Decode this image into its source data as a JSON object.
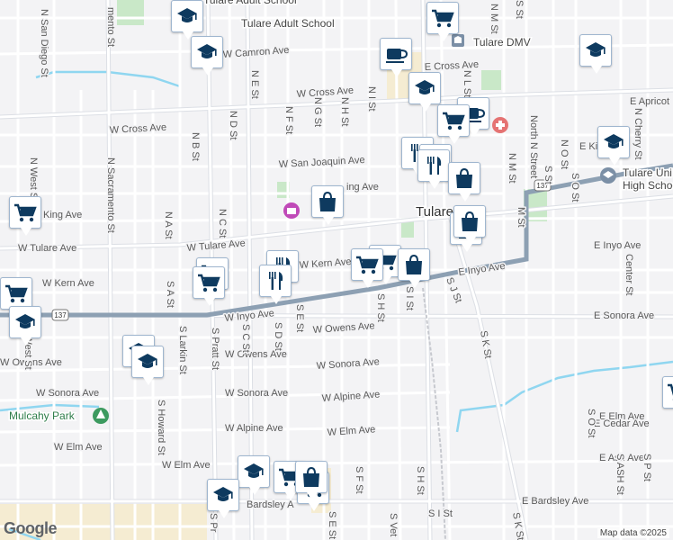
{
  "map": {
    "attribution": "Map data ©2025",
    "logo": "Google",
    "city_label": "Tulare",
    "highway_shield": "137",
    "poi_labels": {
      "adult_school": "Tulare Adult School",
      "dmv": "Tulare DMV",
      "high_school_1": "Tulare Uni",
      "high_school_2": "High School",
      "park": "Mulcahy Park"
    },
    "street_labels": {
      "n_san_diego": "N San Diego St",
      "n_sacramento": "N Sacramento St",
      "n_west": "N West St",
      "s_west": "S West St",
      "n_b": "N B St",
      "n_a": "N A St",
      "n_c": "N C St",
      "n_d": "N D St",
      "n_e": "N E St",
      "n_f": "N F St",
      "n_g": "N G St",
      "n_h": "N H St",
      "n_i": "N I St",
      "n_l": "N L St",
      "n_m": "N M St",
      "m_st": "M St",
      "n_o": "N O St",
      "north_n": "North N Street",
      "s_st": "S St",
      "n_cherry": "N Cherry St",
      "s_o_top": "S O St",
      "memento": "mento St",
      "w_camron": "W Camron Ave",
      "w_cross_1": "W Cross Ave",
      "w_cross_2": "W Cross Ave",
      "e_cross": "E Cross Ave",
      "e_apricot": "E Apricot",
      "e_king": "E King",
      "w_san_joaquin": "W San Joaquin Ave",
      "king_ave": "King Ave",
      "ing_ave": "ing Ave",
      "w_tulare": "W Tulare Ave",
      "w_kern_1": "W Kern Ave",
      "w_kern_2": "W Kern Ave",
      "w_inyo": "W Inyo Ave",
      "e_inyo_1": "E Inyo Ave",
      "e_inyo_2": "E Inyo Ave",
      "w_owens_1": "W Owens Ave",
      "w_owens_2": "W Owens Ave",
      "w_sonora_1": "W Sonora Ave",
      "w_sonora_2": "W Sonora Ave",
      "w_sonora_3": "W Sonora Ave",
      "e_sonora": "E Sonora Ave",
      "w_alpine_1": "W Alpine Ave",
      "w_alpine_2": "W Alpine Ave",
      "w_elm_1": "W Elm Ave",
      "w_elm_2": "W Elm Ave",
      "w_elm_3": "W Elm Ave",
      "e_elm": "E Elm Ave",
      "e_cedar": "E Cedar Ave",
      "e_ash": "E Ash Ave",
      "e_bardsley": "E Bardsley Ave",
      "bardsley": "Bardsley A",
      "s_a": "S A St",
      "s_larkin": "S Larkin St",
      "s_pratt": "S Pratt St",
      "s_c": "S C St",
      "s_d": "S D St",
      "s_e": "S E St",
      "s_e_2": "S E St",
      "s_f": "S F St",
      "s_h": "S H St",
      "s_h_2": "S H St",
      "s_i": "S I St",
      "s_i_2": "S I St",
      "s_j": "S J St",
      "s_k": "S K St",
      "s_k_2": "S K St",
      "s_howard": "S Howard St",
      "center": "Center St",
      "s_o": "S O St",
      "s_p": "S P St",
      "s_ash": "S ASH St",
      "s_vet": "S Vet",
      "s_pr": "S Pr",
      "s_st_2": "S St",
      "s_dt": "S D St"
    },
    "markers": [
      {
        "type": "school"
      },
      {
        "type": "school"
      },
      {
        "type": "shopping-cart"
      },
      {
        "type": "cafe"
      },
      {
        "type": "school"
      },
      {
        "type": "school"
      },
      {
        "type": "cafe"
      },
      {
        "type": "shopping-cart"
      },
      {
        "type": "shopping-cart"
      },
      {
        "type": "school"
      },
      {
        "type": "restaurant"
      },
      {
        "type": "restaurant"
      },
      {
        "type": "restaurant"
      },
      {
        "type": "shopping-bag"
      },
      {
        "type": "shopping-bag"
      },
      {
        "type": "shopping-bag"
      },
      {
        "type": "shopping-cart"
      },
      {
        "type": "shopping-cart"
      },
      {
        "type": "shopping-cart"
      },
      {
        "type": "restaurant"
      },
      {
        "type": "restaurant"
      },
      {
        "type": "shopping-bag"
      },
      {
        "type": "shopping-cart"
      },
      {
        "type": "shopping-cart"
      },
      {
        "type": "shopping-bag"
      },
      {
        "type": "school"
      },
      {
        "type": "school"
      },
      {
        "type": "school"
      },
      {
        "type": "school"
      },
      {
        "type": "shopping-cart"
      },
      {
        "type": "shopping-cart"
      },
      {
        "type": "shopping-bag"
      },
      {
        "type": "shopping-cart"
      },
      {
        "type": "school"
      }
    ],
    "colors": {
      "marker_icon": "#0e3a5f",
      "highway": "#8da0b3",
      "park": "#c9e8c8",
      "water": "#8fd6f0"
    }
  }
}
